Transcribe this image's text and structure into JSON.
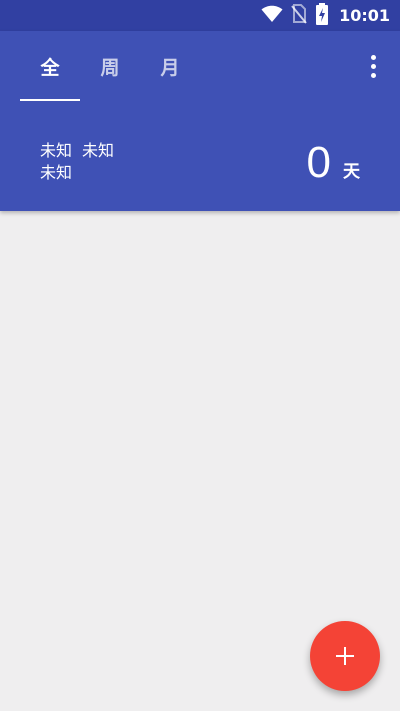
{
  "status_bar": {
    "time": "10:01",
    "icons": [
      "wifi-icon",
      "no-sim-icon",
      "battery-charging-icon"
    ]
  },
  "tabs": [
    {
      "label": "全",
      "active": true
    },
    {
      "label": "周",
      "active": false
    },
    {
      "label": "月",
      "active": false
    }
  ],
  "menu": {
    "icon": "more-vert-icon"
  },
  "summary": {
    "line1_a": "未知",
    "line1_b": "未知",
    "line2": "未知"
  },
  "count": {
    "value": "0",
    "unit": "天"
  },
  "fab": {
    "icon": "plus-icon"
  },
  "colors": {
    "status_bar": "#3140A2",
    "app_bar": "#3F51B5",
    "background": "#EFEEEF",
    "fab": "#F44336"
  }
}
